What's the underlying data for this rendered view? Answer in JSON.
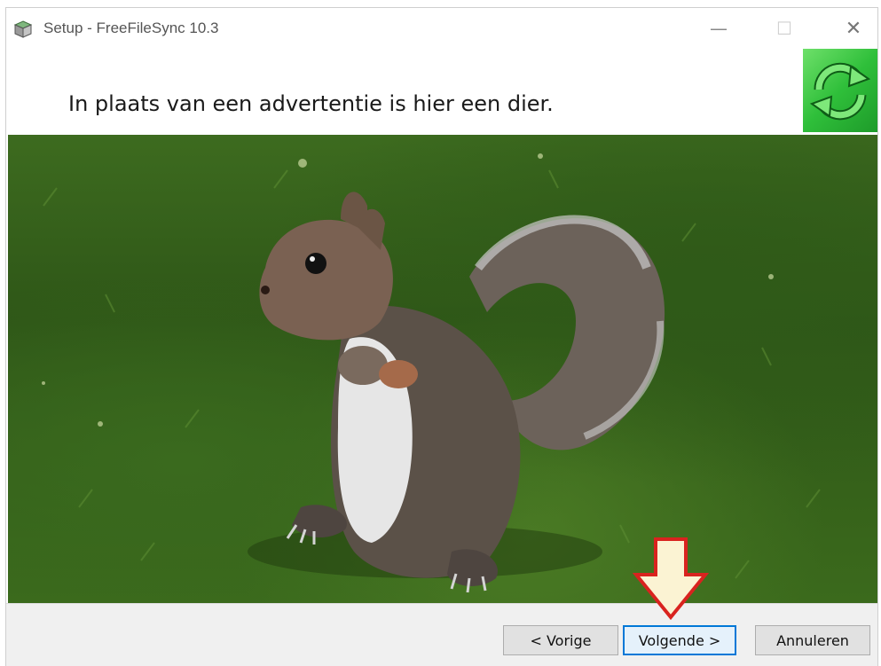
{
  "window": {
    "title": "Setup - FreeFileSync 10.3",
    "app_icon": "setup-box-icon",
    "controls": {
      "minimize": "—",
      "maximize": "☐",
      "close": "✕"
    }
  },
  "header": {
    "text": "In plaats van een advertentie is hier een dier.",
    "logo_icon": "freefilesync-sync-arrows-icon"
  },
  "content": {
    "image": "squirrel-photo"
  },
  "footer": {
    "prev_label": "< Vorige",
    "next_label": "Volgende >",
    "cancel_label": "Annuleren"
  },
  "annotation": {
    "icon": "red-down-arrow-icon",
    "fill_color": "#fbf3d3",
    "stroke_color": "#d9231f"
  },
  "colors": {
    "accent": "#0078d7",
    "logo_green": "#2fbf3a"
  }
}
